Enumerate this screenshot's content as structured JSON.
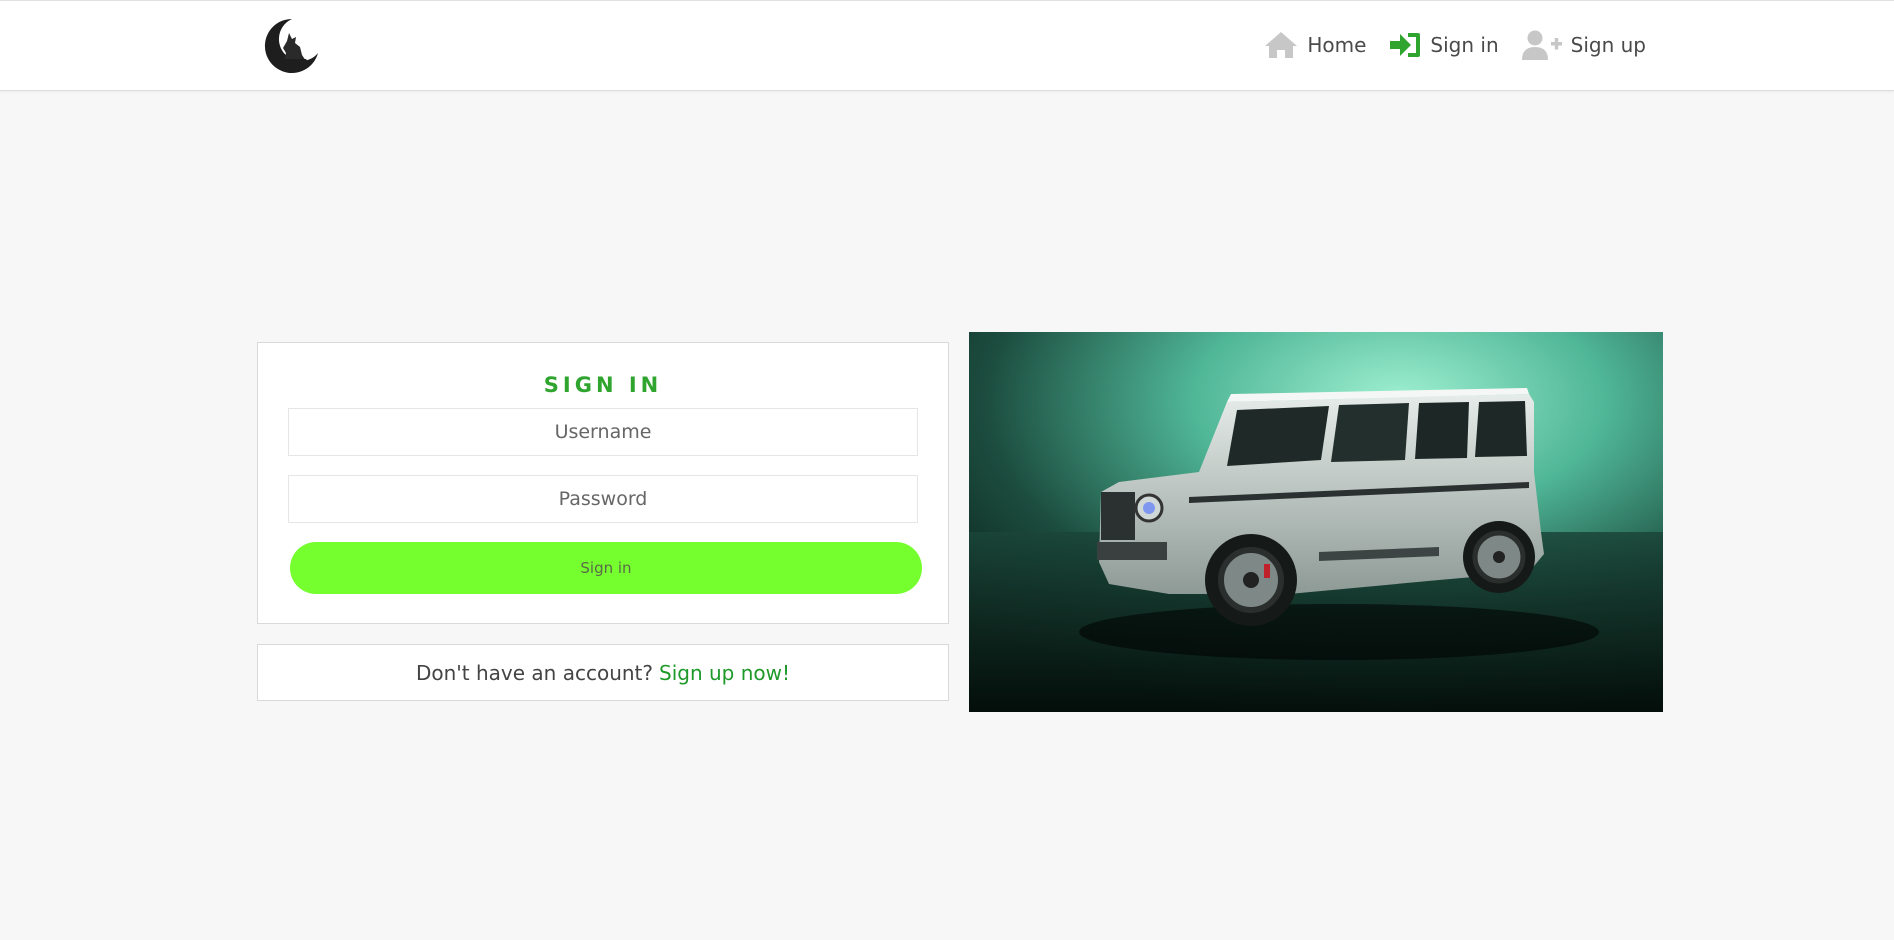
{
  "nav": {
    "logo_icon": "wolf-moon-logo",
    "links": [
      {
        "label": "Home",
        "icon": "home-icon",
        "color": "#c7c7c7"
      },
      {
        "label": "Sign in",
        "icon": "sign-in-icon",
        "color": "#2fa52f"
      },
      {
        "label": "Sign up",
        "icon": "user-plus-icon",
        "color": "#c7c7c7"
      }
    ]
  },
  "signin": {
    "title": "SIGN IN",
    "username_placeholder": "Username",
    "password_placeholder": "Password",
    "submit_label": "Sign in"
  },
  "signup_prompt": {
    "text": "Don't have an account?",
    "link_label": "Sign up now!"
  },
  "colors": {
    "accent_green": "#2fa52f",
    "button_green": "#76ff2e",
    "link_green": "#1f9a2a",
    "page_bg": "#f7f7f7"
  }
}
